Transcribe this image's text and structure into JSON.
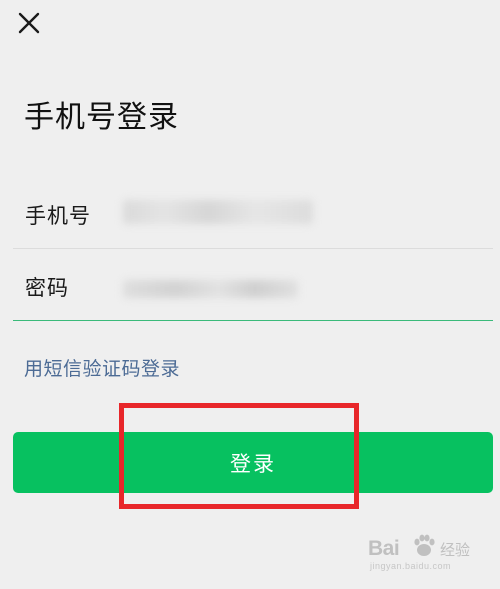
{
  "header": {
    "close_icon": "close-icon",
    "title": "手机号登录"
  },
  "form": {
    "phone": {
      "label": "手机号",
      "value_state": "obscured"
    },
    "password": {
      "label": "密码",
      "value_state": "obscured",
      "focused": true
    },
    "sms_login_link": "用短信验证码登录",
    "login_button": "登录"
  },
  "annotation": {
    "highlight_color": "#e8262a",
    "target": "login-button"
  },
  "watermark": {
    "logo_prefix": "Bai",
    "logo_suffix": "经验",
    "url": "jingyan.baidu.com"
  },
  "colors": {
    "background": "#efefef",
    "primary_green": "#07c160",
    "link_blue": "#4c6b95",
    "focus_underline": "#3aba7a"
  }
}
